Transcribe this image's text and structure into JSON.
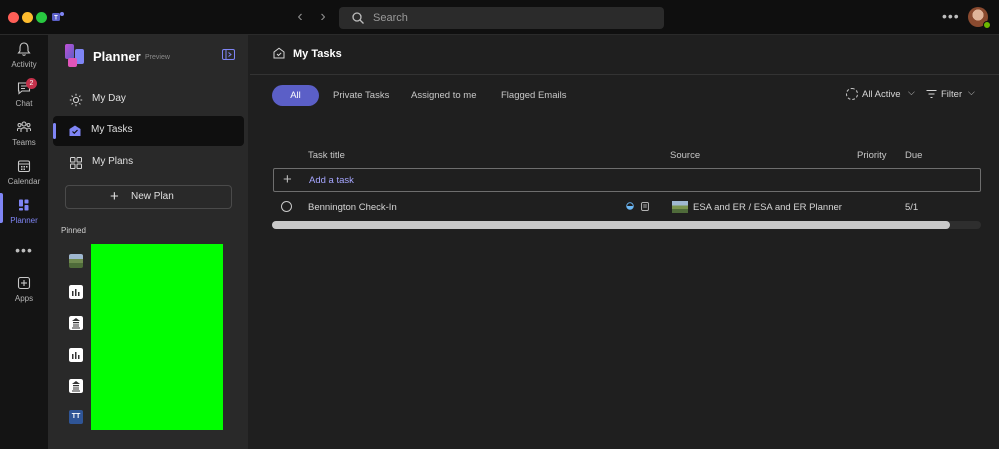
{
  "topbar": {
    "search_placeholder": "Search",
    "more_label": "•••"
  },
  "rail": {
    "items": [
      {
        "label": "Activity",
        "icon": "bell-icon"
      },
      {
        "label": "Chat",
        "icon": "chat-icon",
        "badge": "2"
      },
      {
        "label": "Teams",
        "icon": "teams-icon"
      },
      {
        "label": "Calendar",
        "icon": "calendar-icon"
      },
      {
        "label": "Planner",
        "icon": "planner-icon",
        "active": true
      },
      {
        "label": "Apps",
        "icon": "apps-icon"
      }
    ],
    "more_label": "•••"
  },
  "sidepanel": {
    "title": "Planner",
    "preview": "Preview",
    "nav": [
      {
        "label": "My Day",
        "icon": "sun-icon"
      },
      {
        "label": "My Tasks",
        "icon": "my-tasks-icon",
        "active": true
      },
      {
        "label": "My Plans",
        "icon": "grid-icon"
      }
    ],
    "new_plan_label": "New Plan",
    "pinned_label": "Pinned",
    "pinned_icons": [
      "landscape-icon",
      "chart-icon",
      "building-icon",
      "chart-icon",
      "building-icon",
      "tt-initials-icon"
    ],
    "tt_initials": "TT"
  },
  "main": {
    "title": "My Tasks",
    "tabs": [
      {
        "label": "All",
        "active": true
      },
      {
        "label": "Private Tasks"
      },
      {
        "label": "Assigned to me"
      },
      {
        "label": "Flagged Emails"
      }
    ],
    "status_filter": "All Active",
    "filter_label": "Filter",
    "columns": {
      "title": "Task title",
      "source": "Source",
      "priority": "Priority",
      "due": "Due"
    },
    "add_task_label": "Add a task",
    "tasks": [
      {
        "title": "Bennington Check-In",
        "source": "ESA and ER / ESA and ER Planner",
        "priority": "",
        "due": "5/1"
      }
    ]
  },
  "colors": {
    "accent": "#5b5fc7",
    "accent_light": "#7f85f5",
    "badge": "#c4314b",
    "redacted": "#00ff00"
  }
}
